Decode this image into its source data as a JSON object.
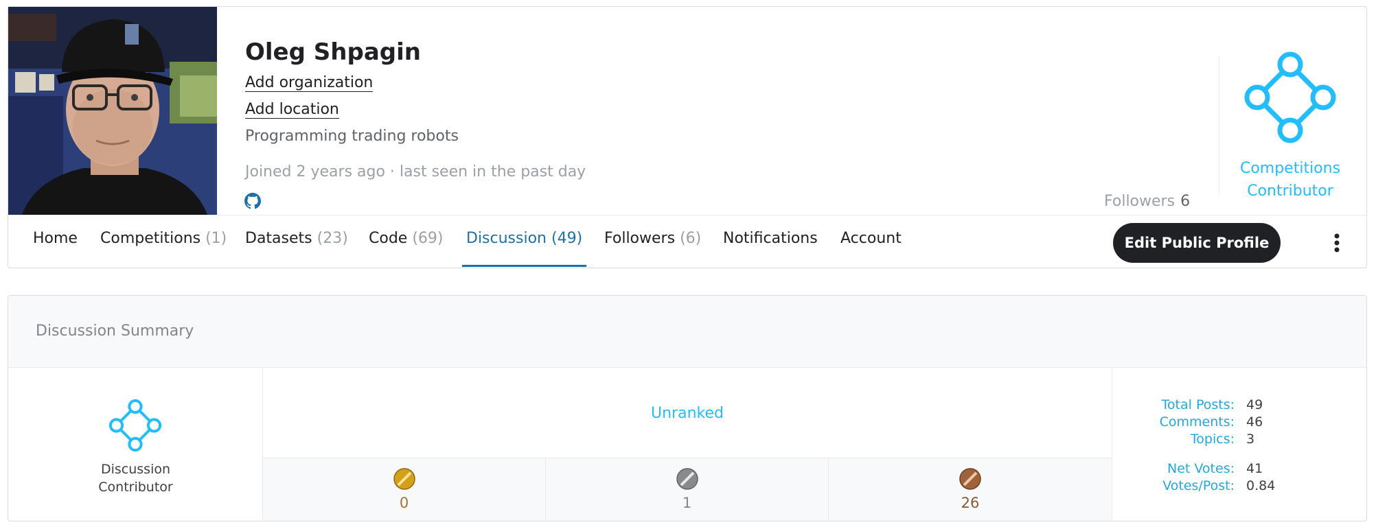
{
  "profile": {
    "name": "Oleg Shpagin",
    "add_organization": "Add organization",
    "add_location": "Add location",
    "bio": "Programming trading robots",
    "joined": "Joined 2 years ago · last seen in the past day",
    "social_icon": "github-icon",
    "followers_label": "Followers",
    "followers_count": "6",
    "tier_line1": "Competitions",
    "tier_line2": "Contributor",
    "tier_icon": "contributor-diamond-icon",
    "accent_color": "#20beff"
  },
  "nav": {
    "tabs": [
      {
        "label": "Home",
        "count": ""
      },
      {
        "label": "Competitions",
        "count": "(1)"
      },
      {
        "label": "Datasets",
        "count": "(23)"
      },
      {
        "label": "Code",
        "count": "(69)"
      },
      {
        "label": "Discussion",
        "count": "(49)"
      },
      {
        "label": "Followers",
        "count": "(6)"
      },
      {
        "label": "Notifications",
        "count": ""
      },
      {
        "label": "Account",
        "count": ""
      }
    ],
    "active_tab": "Discussion",
    "edit_button": "Edit Public Profile",
    "more_icon": "vertical-ellipsis-icon"
  },
  "summary": {
    "title": "Discussion Summary",
    "tier_line1": "Discussion",
    "tier_line2": "Contributor",
    "rank": "Unranked",
    "medals": [
      {
        "type": "gold",
        "count": "0",
        "color": "#d4a017"
      },
      {
        "type": "silver",
        "count": "1",
        "color": "#8a8a8a"
      },
      {
        "type": "bronze",
        "count": "26",
        "color": "#a0623a"
      }
    ],
    "stats": [
      {
        "label": "Total Posts:",
        "value": "49"
      },
      {
        "label": "Comments:",
        "value": "46"
      },
      {
        "label": "Topics:",
        "value": "3"
      },
      {
        "label": "Net Votes:",
        "value": "41"
      },
      {
        "label": "Votes/Post:",
        "value": "0.84"
      }
    ]
  }
}
